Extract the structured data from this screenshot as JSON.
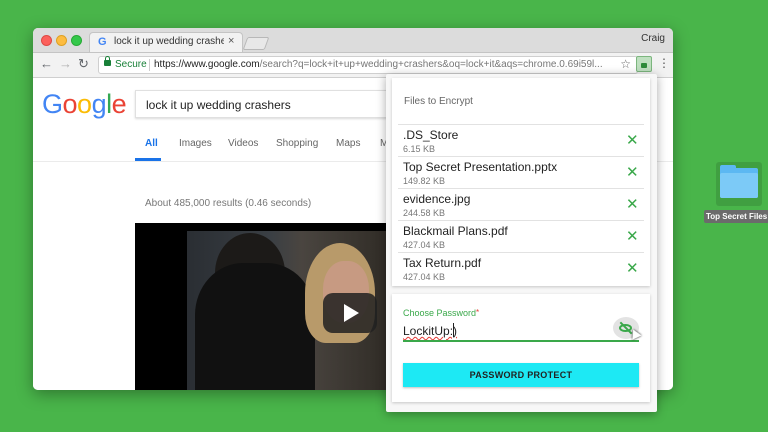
{
  "browser": {
    "tab_title": "lock it up wedding crashers - G",
    "tab_favicon": "G",
    "tab_close": "×",
    "profile_name": "Craig",
    "secure_label": "Secure",
    "url_host": "https://www.google.com",
    "url_rest": "/search?q=lock+it+up+wedding+crashers&oq=lock+it&aqs=chrome.0.69i59l...",
    "back": "←",
    "forward": "→",
    "reload": "↻",
    "star": "☆",
    "menu": "⋮"
  },
  "google": {
    "logo_letters": [
      {
        "char": "G",
        "color": "#4285f4"
      },
      {
        "char": "o",
        "color": "#ea4335"
      },
      {
        "char": "o",
        "color": "#fbbc05"
      },
      {
        "char": "g",
        "color": "#4285f4"
      },
      {
        "char": "l",
        "color": "#34a853"
      },
      {
        "char": "e",
        "color": "#ea4335"
      }
    ],
    "query": "lock it up wedding crashers",
    "tabs": [
      "All",
      "Images",
      "Videos",
      "Shopping",
      "Maps",
      "M"
    ],
    "active_tab": "All",
    "result_stats": "About 485,000 results (0.46 seconds)"
  },
  "popup": {
    "files_title": "Files to Encrypt",
    "files": [
      {
        "name": ".DS_Store",
        "size": "6.15 KB"
      },
      {
        "name": "Top Secret Presentation.pptx",
        "size": "149.82 KB"
      },
      {
        "name": "evidence.jpg",
        "size": "244.58 KB"
      },
      {
        "name": "Blackmail Plans.pdf",
        "size": "427.04 KB"
      },
      {
        "name": "Tax Return.pdf",
        "size": "427.04 KB"
      }
    ],
    "remove_glyph": "✕",
    "password_label": "Choose Password",
    "password_required": "*",
    "password_value": "LockitUp:)",
    "protect_button": "PASSWORD PROTECT",
    "accent_color": "#3aa84a",
    "button_color": "#1de9f4"
  },
  "desktop": {
    "folder_label": "Top Secret Files"
  }
}
